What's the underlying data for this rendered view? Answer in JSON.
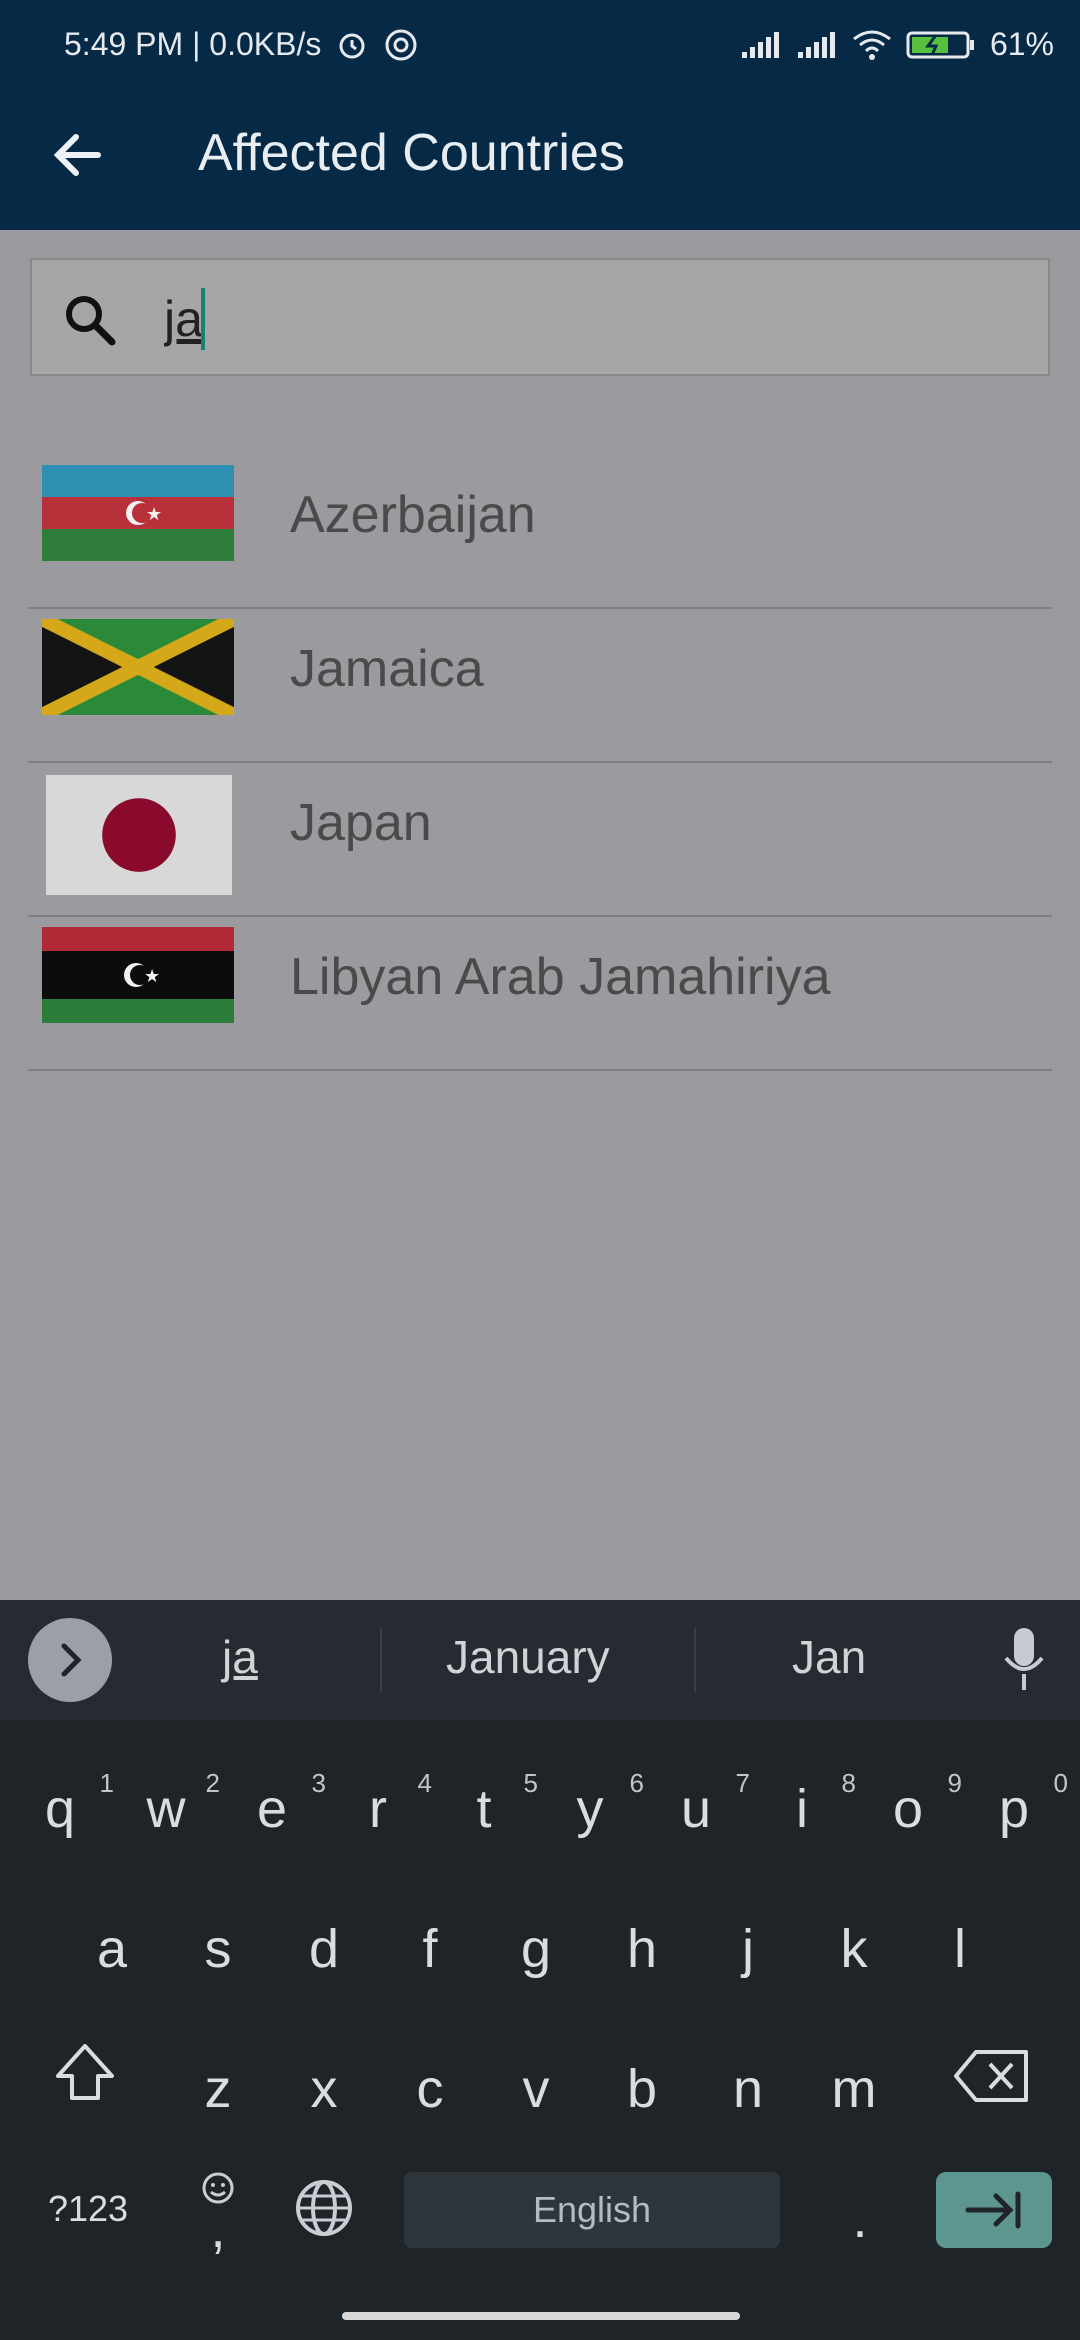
{
  "status": {
    "time": "5:49 PM | 0.0KB/s",
    "battery": "61%"
  },
  "appbar": {
    "title": "Affected Countries"
  },
  "search": {
    "query": "ja"
  },
  "countries": [
    {
      "name": "Azerbaijan",
      "flag": "azerbaijan"
    },
    {
      "name": "Jamaica",
      "flag": "jamaica"
    },
    {
      "name": "Japan",
      "flag": "japan"
    },
    {
      "name": "Libyan Arab Jamahiriya",
      "flag": "libya"
    }
  ],
  "keyboard": {
    "suggestions": [
      "ja",
      "January",
      "Jan"
    ],
    "row1": [
      {
        "k": "q",
        "n": "1"
      },
      {
        "k": "w",
        "n": "2"
      },
      {
        "k": "e",
        "n": "3"
      },
      {
        "k": "r",
        "n": "4"
      },
      {
        "k": "t",
        "n": "5"
      },
      {
        "k": "y",
        "n": "6"
      },
      {
        "k": "u",
        "n": "7"
      },
      {
        "k": "i",
        "n": "8"
      },
      {
        "k": "o",
        "n": "9"
      },
      {
        "k": "p",
        "n": "0"
      }
    ],
    "row2": [
      "a",
      "s",
      "d",
      "f",
      "g",
      "h",
      "j",
      "k",
      "l"
    ],
    "row3": [
      "z",
      "x",
      "c",
      "v",
      "b",
      "n",
      "m"
    ],
    "symbols": "?123",
    "comma": ",",
    "period": ".",
    "space": "English"
  },
  "colors": {
    "appbar": "#062a45",
    "accent": "#5d968f"
  }
}
